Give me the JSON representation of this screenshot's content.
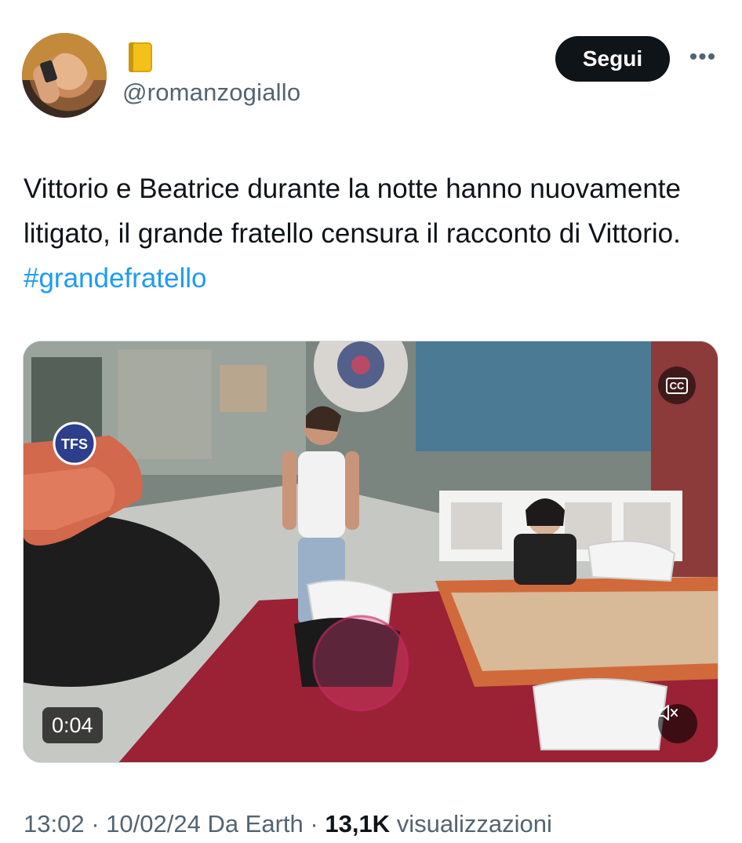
{
  "author": {
    "avatar_icon": "profile-photo",
    "name_emoji": "yellow-notebook-emoji",
    "handle": "@romanzogiallo"
  },
  "actions": {
    "follow_label": "Segui",
    "more_label": "•••"
  },
  "tweet": {
    "text": "Vittorio e Beatrice durante la notte hanno nuovamente litigato, il grande fratello censura il racconto di Vittorio. ",
    "hashtag": "#grandefratello"
  },
  "video": {
    "duration": "0:04",
    "overlay_logo": "TFS",
    "captions_icon": "captions-icon",
    "mute_icon": "speaker-muted-icon"
  },
  "meta": {
    "time": "13:02",
    "date": "10/02/24",
    "source": "Da Earth",
    "separator": " · ",
    "views_count": "13,1K",
    "views_label": "visualizzazioni"
  },
  "colors": {
    "accent": "#1d9bf0",
    "text_primary": "#0f1419",
    "text_secondary": "#536471",
    "button_bg": "#0f1419"
  }
}
